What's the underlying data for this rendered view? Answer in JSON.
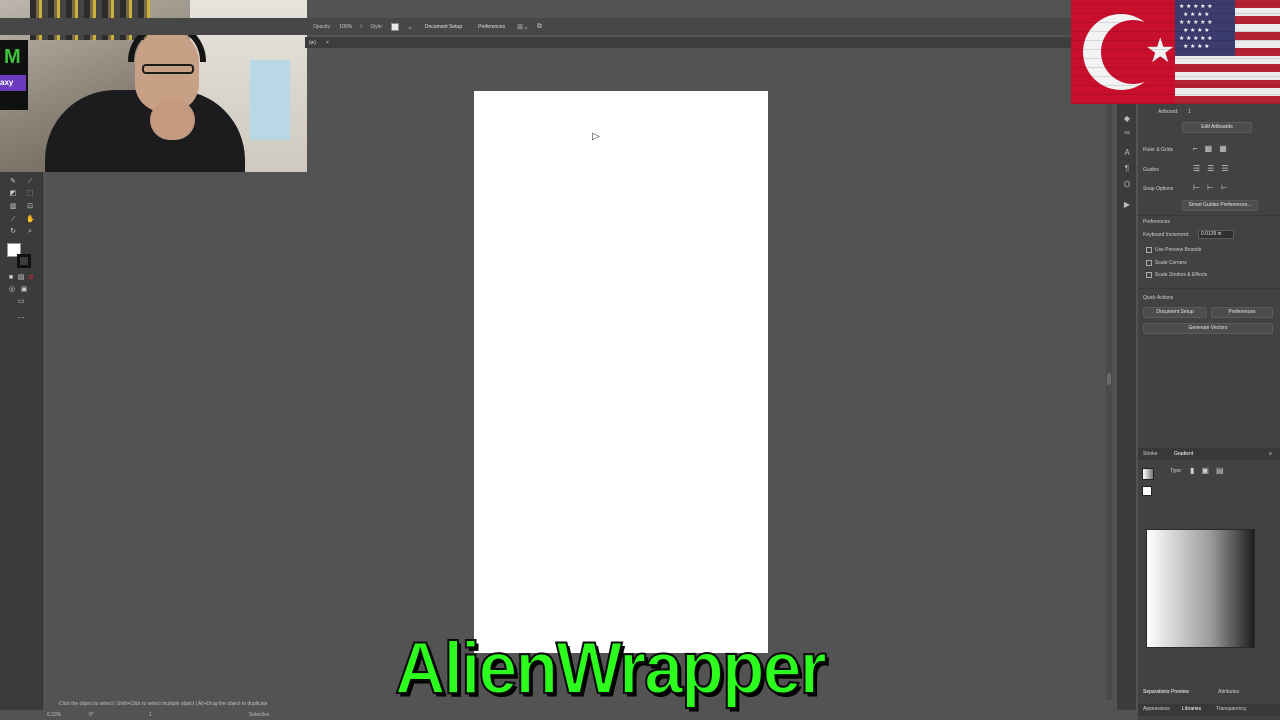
{
  "controlbar": {
    "opacity_label": "Opacity:",
    "opacity_value": "100%",
    "style_label": "Style:",
    "document_setup": "Document Setup",
    "preferences": "Preferences"
  },
  "doc_tab": {
    "name": "(w)",
    "close": "×"
  },
  "overlay": {
    "brand": "AlienWrapper",
    "webcam_shirt_text": "axy"
  },
  "statusbar": {
    "hint": "Click the object to select  |  Shift+Click to select multiple object  |  Alt+Drag the object to duplicate",
    "zoom": "6.33%",
    "rotation": "0°",
    "page": "1",
    "tool": "Selection"
  },
  "properties": {
    "artboard_label": "Artboard:",
    "artboard_value": "1",
    "edit_artboards": "Edit Artboards",
    "rulers_grids": "Ruler & Grids",
    "guides": "Guides",
    "snap_options": "Snap Options",
    "smart_guides_prefs": "Smart Guides Preferences...",
    "preferences_header": "Preferences",
    "keyboard_increment_label": "Keyboard Increment:",
    "keyboard_increment_value": "0.0139 in",
    "use_preview_bounds": "Use Preview Bounds",
    "scale_corners": "Scale Corners",
    "scale_strokes": "Scale Strokes & Effects",
    "quick_actions": "Quick Actions",
    "document_setup": "Document Setup",
    "preferences": "Preferences",
    "generate_vectors": "Generate Vectors"
  },
  "gradient_panel": {
    "tab_stroke": "Stroke",
    "tab_gradient": "Gradient",
    "type_label": "Type:"
  },
  "bottom_tabs": {
    "separations_preview": "Separations Preview",
    "attributes": "Attributes",
    "appearance": "Appearance",
    "libraries": "Libraries",
    "transparency": "Transparency"
  },
  "colors": {
    "canvas_bg": "#535353",
    "artboard": "#ffffff",
    "brand_text": "#2cff1e"
  }
}
